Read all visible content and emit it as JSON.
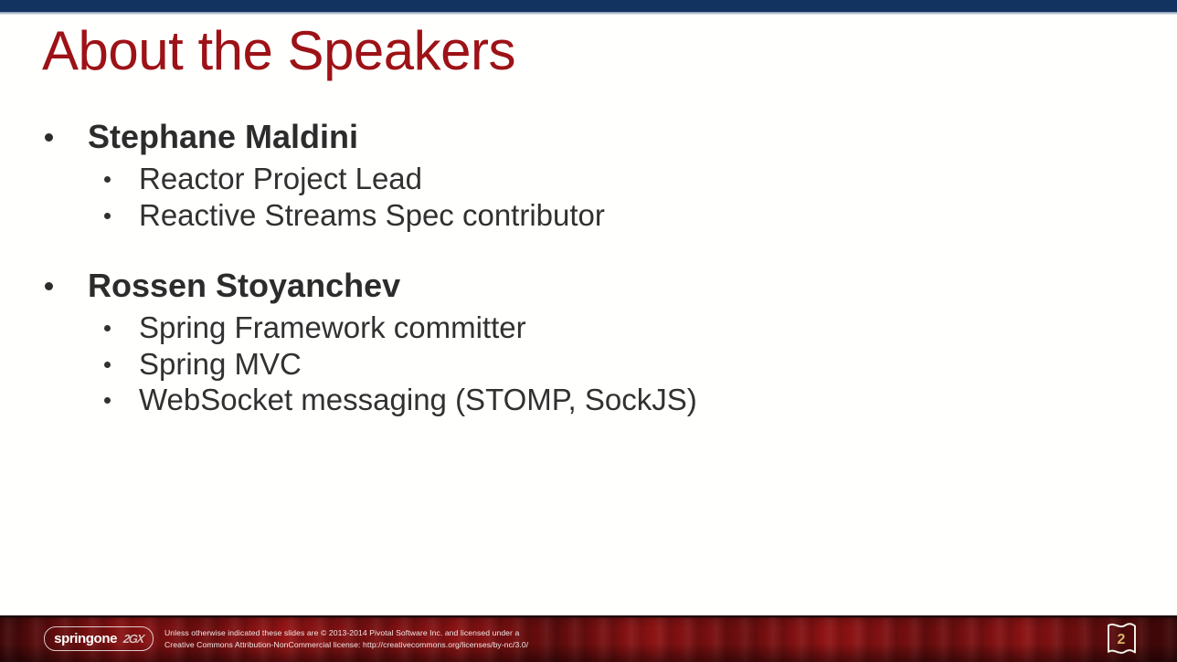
{
  "slide": {
    "title": "About the Speakers",
    "title_color": "#9d1217",
    "background_color": "#fffffd",
    "top_band_color": "#12325f",
    "body_text_color": "#2c2c2c"
  },
  "speakers": [
    {
      "name": "Stephane Maldini",
      "roles": [
        "Reactor Project Lead",
        "Reactive Streams Spec contributor"
      ]
    },
    {
      "name": "Rossen Stoyanchev",
      "roles": [
        "Spring Framework committer",
        "Spring MVC",
        "WebSocket messaging (STOMP, SockJS)"
      ]
    }
  ],
  "footer": {
    "logo_word": "springone",
    "logo_mark": "2GX",
    "license_line1": "Unless otherwise indicated these slides are © 2013-2014 Pivotal Software Inc. and licensed under a",
    "license_line2": "Creative Commons Attribution-NonCommercial license: http://creativecommons.org/licenses/by-nc/3.0/",
    "page_number": "2",
    "background_color": "#8d1213",
    "page_number_color": "#d9b566"
  }
}
